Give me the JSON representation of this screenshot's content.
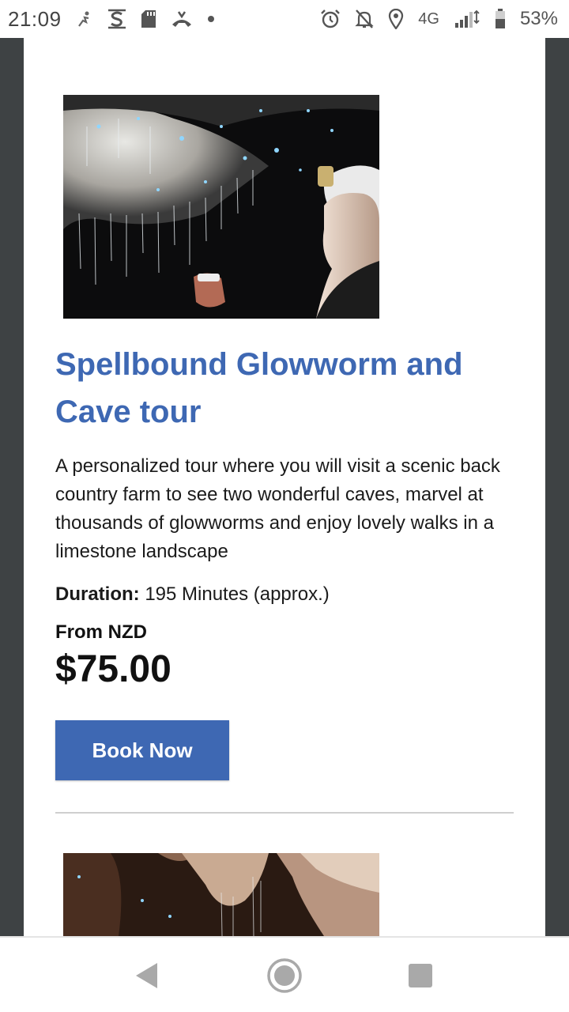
{
  "status_bar": {
    "time": "21:09",
    "network": "4G",
    "battery": "53%",
    "icons": [
      "activity-icon",
      "s-app-icon",
      "sd-card-icon",
      "call-icon",
      "dot-icon",
      "alarm-icon",
      "notifications-off-icon",
      "location-icon",
      "signal-icon",
      "battery-icon"
    ]
  },
  "tour": {
    "image_alt": "Person wearing a helmet looking at glowworms on a cave ceiling",
    "title": "Spellbound Glowworm and Cave tour",
    "description": "A personalized tour where you will visit a scenic back country farm to see two wonderful caves, marvel at thousands of glowworms and enjoy lovely walks in a limestone landscape",
    "duration_label": "Duration:",
    "duration_value": " 195 Minutes (approx.)",
    "price_prefix": "From NZD",
    "price": "$75.00",
    "book_label": "Book Now"
  },
  "next_tour": {
    "image_alt": "Limestone cave interior"
  },
  "nav_bar": {
    "buttons": [
      "back-icon",
      "home-icon",
      "recents-icon"
    ]
  },
  "colors": {
    "accent": "#3e68b3",
    "page_margin": "#3e4244",
    "text": "#1b1b1b"
  }
}
